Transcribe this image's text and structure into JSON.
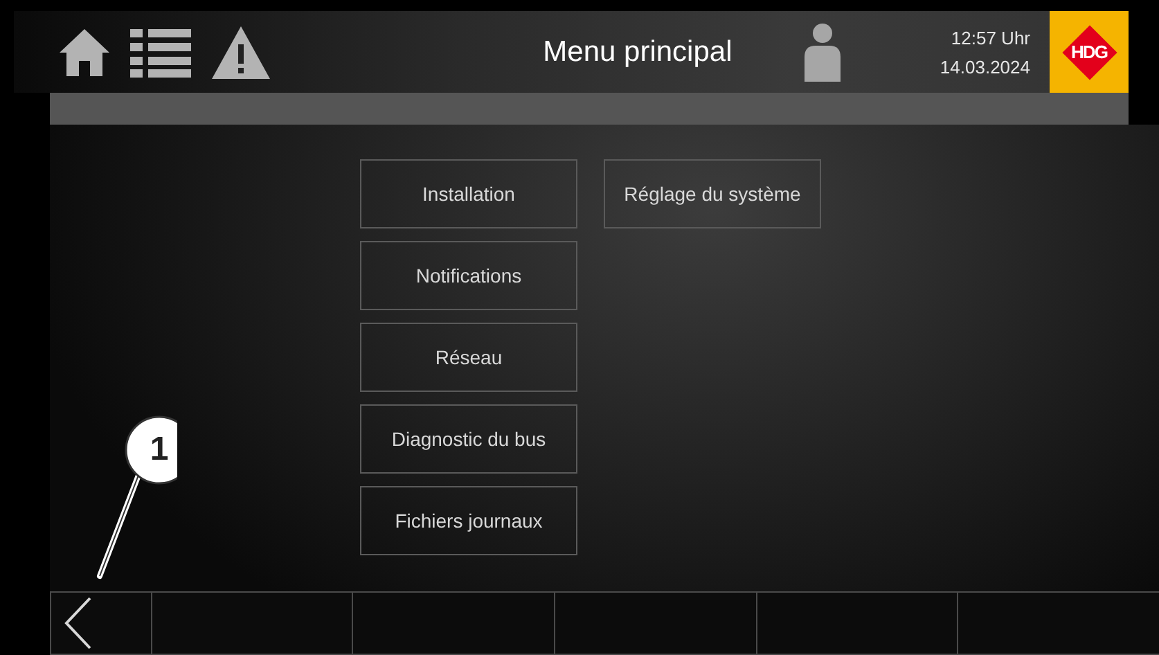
{
  "header": {
    "title": "Menu principal",
    "time": "12:57 Uhr",
    "date": "14.03.2024",
    "logo": "HDG"
  },
  "menu": {
    "columns": [
      [
        "Installation",
        "Notifications",
        "Réseau",
        "Diagnostic du bus",
        "Fichiers journaux"
      ],
      [
        "Réglage du système"
      ]
    ]
  },
  "footer": {
    "buttons": [
      {
        "kind": "back"
      },
      {
        "kind": "empty"
      },
      {
        "kind": "empty"
      },
      {
        "kind": "empty"
      },
      {
        "kind": "empty"
      },
      {
        "kind": "empty"
      }
    ]
  },
  "callout": {
    "label": "1"
  }
}
